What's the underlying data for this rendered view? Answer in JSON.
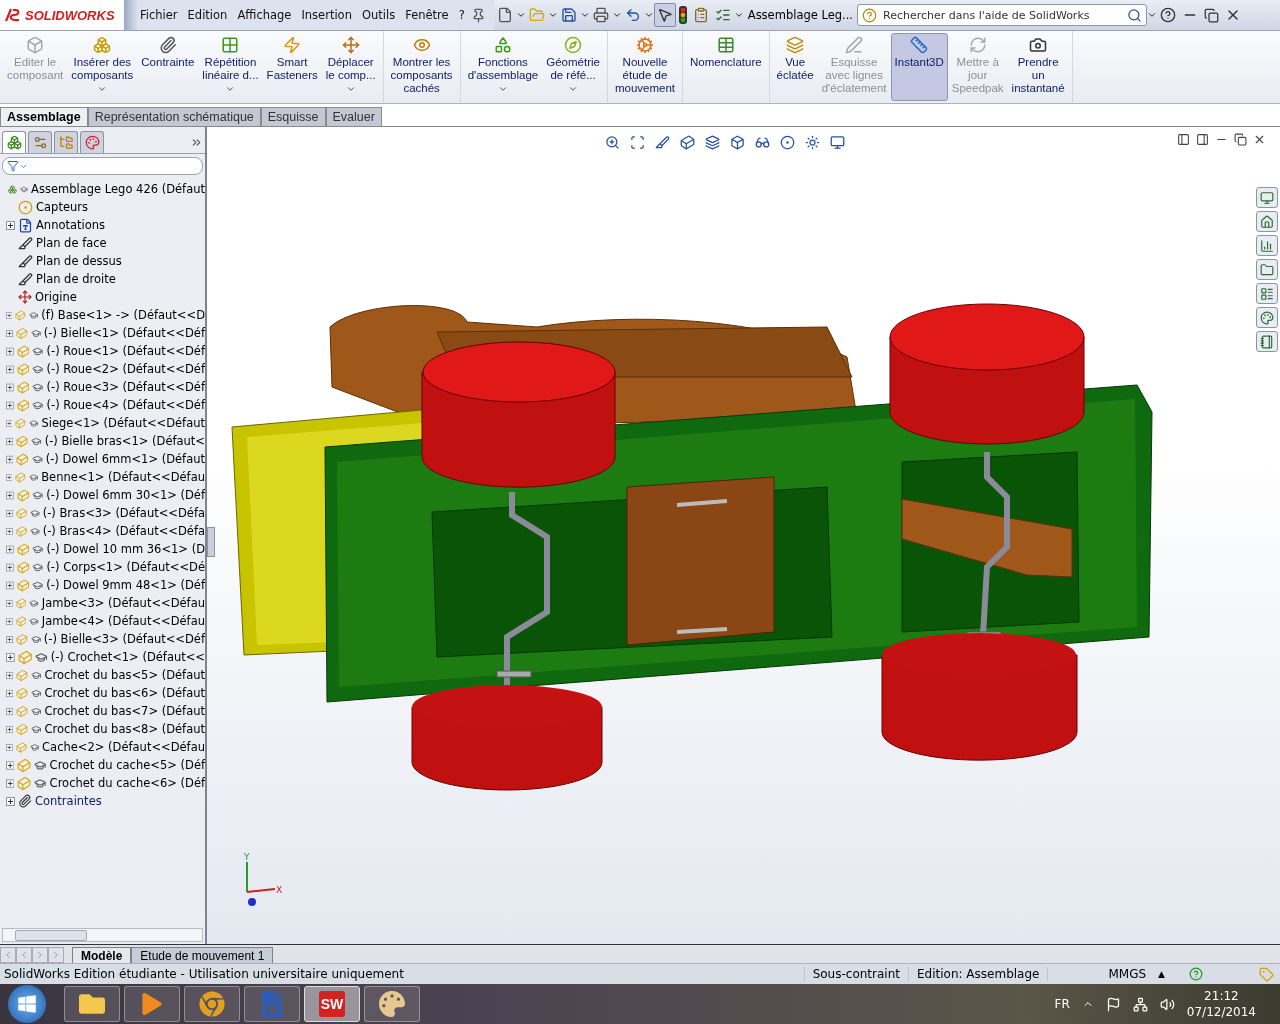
{
  "app": {
    "logo": "SOLIDWORKS",
    "menu": [
      "Fichier",
      "Edition",
      "Affichage",
      "Insertion",
      "Outils",
      "Fenêtre",
      "?"
    ],
    "document_title": "Assemblage Leg...",
    "search": {
      "placeholder": "Rechercher dans l'aide de SolidWorks"
    }
  },
  "ribbon": [
    [
      {
        "lines": [
          "Editer le",
          "composant"
        ],
        "disabled": true,
        "selected": false,
        "dropdown": false
      },
      {
        "lines": [
          "Insérer des",
          "composants"
        ],
        "disabled": false,
        "selected": false,
        "dropdown": true
      },
      {
        "lines": [
          "Contrainte"
        ],
        "disabled": false,
        "selected": false,
        "dropdown": false
      },
      {
        "lines": [
          "Répétition",
          "linéaire d..."
        ],
        "disabled": false,
        "selected": false,
        "dropdown": true
      },
      {
        "lines": [
          "Smart",
          "Fasteners"
        ],
        "disabled": false,
        "selected": false,
        "dropdown": false
      },
      {
        "lines": [
          "Déplacer",
          "le comp..."
        ],
        "disabled": false,
        "selected": false,
        "dropdown": true
      }
    ],
    [
      {
        "lines": [
          "Montrer les",
          "composants",
          "cachés"
        ],
        "disabled": false,
        "selected": false,
        "dropdown": false
      }
    ],
    [
      {
        "lines": [
          "Fonctions",
          "d'assemblage"
        ],
        "disabled": false,
        "selected": false,
        "dropdown": true
      },
      {
        "lines": [
          "Géométrie",
          "de réfé..."
        ],
        "disabled": false,
        "selected": false,
        "dropdown": true
      }
    ],
    [
      {
        "lines": [
          "Nouvelle",
          "étude de",
          "mouvement"
        ],
        "disabled": false,
        "selected": false,
        "dropdown": false
      }
    ],
    [
      {
        "lines": [
          "Nomenclature"
        ],
        "disabled": false,
        "selected": false,
        "dropdown": false
      }
    ],
    [
      {
        "lines": [
          "Vue",
          "éclatée"
        ],
        "disabled": false,
        "selected": false,
        "dropdown": false
      },
      {
        "lines": [
          "Esquisse",
          "avec lignes",
          "d'éclatement"
        ],
        "disabled": true,
        "selected": false,
        "dropdown": false
      },
      {
        "lines": [
          "Instant3D"
        ],
        "disabled": false,
        "selected": true,
        "dropdown": false
      },
      {
        "lines": [
          "Mettre à",
          "jour",
          "Speedpak"
        ],
        "disabled": true,
        "selected": false,
        "dropdown": false
      },
      {
        "lines": [
          "Prendre",
          "un",
          "instantané"
        ],
        "disabled": false,
        "selected": false,
        "dropdown": false
      }
    ]
  ],
  "command_tabs": [
    {
      "label": "Assemblage",
      "selected": true
    },
    {
      "label": "Représentation schématique",
      "selected": false
    },
    {
      "label": "Esquisse",
      "selected": false
    },
    {
      "label": "Evaluer",
      "selected": false
    }
  ],
  "panel_tabs": [
    {
      "selected": true
    },
    {
      "selected": false
    },
    {
      "selected": false
    },
    {
      "selected": false
    }
  ],
  "tree": {
    "label": "Assemblage Lego 426  (Défaut",
    "kind": "assembly",
    "children": [
      {
        "label": "Capteurs",
        "kind": "sensors",
        "collapsed": false
      },
      {
        "label": "Annotations",
        "kind": "annotations",
        "collapsed": true
      },
      {
        "label": "Plan de face",
        "kind": "plane",
        "collapsed": false
      },
      {
        "label": "Plan de dessus",
        "kind": "plane",
        "collapsed": false
      },
      {
        "label": "Plan de droite",
        "kind": "plane",
        "collapsed": false
      },
      {
        "label": "Origine",
        "kind": "origin",
        "collapsed": false
      },
      {
        "label": "(f) Base<1> -> (Défaut<<D",
        "kind": "part",
        "collapsed": true
      },
      {
        "label": "(-) Bielle<1> (Défaut<<Déf",
        "kind": "part",
        "collapsed": true
      },
      {
        "label": "(-) Roue<1> (Défaut<<Déf",
        "kind": "part",
        "collapsed": true
      },
      {
        "label": "(-) Roue<2> (Défaut<<Déf",
        "kind": "part",
        "collapsed": true
      },
      {
        "label": "(-) Roue<3> (Défaut<<Déf",
        "kind": "part",
        "collapsed": true
      },
      {
        "label": "(-) Roue<4> (Défaut<<Déf",
        "kind": "part",
        "collapsed": true
      },
      {
        "label": "Siege<1> (Défaut<<Défaut",
        "kind": "part",
        "collapsed": true
      },
      {
        "label": "(-) Bielle bras<1> (Défaut<",
        "kind": "part",
        "collapsed": true
      },
      {
        "label": "(-) Dowel 6mm<1> (Défaut",
        "kind": "part",
        "collapsed": true
      },
      {
        "label": "Benne<1> (Défaut<<Défau",
        "kind": "part",
        "collapsed": true
      },
      {
        "label": "(-) Dowel 6mm 30<1> (Déf",
        "kind": "part",
        "collapsed": true
      },
      {
        "label": "(-) Bras<3> (Défaut<<Défa",
        "kind": "part",
        "collapsed": true
      },
      {
        "label": "(-) Bras<4> (Défaut<<Défa",
        "kind": "part",
        "collapsed": true
      },
      {
        "label": "(-) Dowel 10 mm 36<1> (D",
        "kind": "part",
        "collapsed": true
      },
      {
        "label": "(-) Corps<1> (Défaut<<Dé",
        "kind": "part",
        "collapsed": true
      },
      {
        "label": "(-) Dowel 9mm 48<1> (Déf",
        "kind": "part",
        "collapsed": true
      },
      {
        "label": "Jambe<3> (Défaut<<Défau",
        "kind": "part",
        "collapsed": true
      },
      {
        "label": "Jambe<4> (Défaut<<Défau",
        "kind": "part",
        "collapsed": true
      },
      {
        "label": "(-) Bielle<3> (Défaut<<Déf",
        "kind": "part",
        "collapsed": true
      },
      {
        "label": "(-) Crochet<1> (Défaut<<",
        "kind": "part",
        "collapsed": true
      },
      {
        "label": "Crochet du bas<5> (Défaut",
        "kind": "part",
        "collapsed": true
      },
      {
        "label": "Crochet du bas<6> (Défaut",
        "kind": "part",
        "collapsed": true
      },
      {
        "label": "Crochet du bas<7> (Défaut",
        "kind": "part",
        "collapsed": true
      },
      {
        "label": "Crochet du bas<8> (Défaut",
        "kind": "part",
        "collapsed": true
      },
      {
        "label": "Cache<2> (Défaut<<Défau",
        "kind": "part",
        "collapsed": true
      },
      {
        "label": "Crochet du cache<5> (Déf",
        "kind": "part",
        "collapsed": true
      },
      {
        "label": "Crochet du cache<6> (Déf",
        "kind": "part",
        "collapsed": true
      },
      {
        "label": "Contraintes",
        "kind": "mates",
        "collapsed": true
      }
    ]
  },
  "triad": {
    "y_label": "Y",
    "x_label": "X"
  },
  "bottom_tabs": [
    {
      "label": "Modèle",
      "selected": true
    },
    {
      "label": "Etude de mouvement 1",
      "selected": false
    }
  ],
  "status_bar": {
    "message": "SolidWorks Edition étudiante - Utilisation universitaire uniquement",
    "constraint": "Sous-contraint",
    "mode": "Edition: Assemblage",
    "units": "MMGS",
    "units_caret": "▲"
  },
  "taskbar": {
    "apps": [
      {
        "kind": "folder",
        "selected": false
      },
      {
        "kind": "media",
        "selected": false
      },
      {
        "kind": "browser",
        "selected": false
      },
      {
        "kind": "word",
        "selected": false
      },
      {
        "kind": "solidworks",
        "glyph": "SW",
        "selected": true
      },
      {
        "kind": "paint",
        "selected": false
      }
    ],
    "language": "FR",
    "time": "21:12",
    "date": "07/12/2014"
  }
}
